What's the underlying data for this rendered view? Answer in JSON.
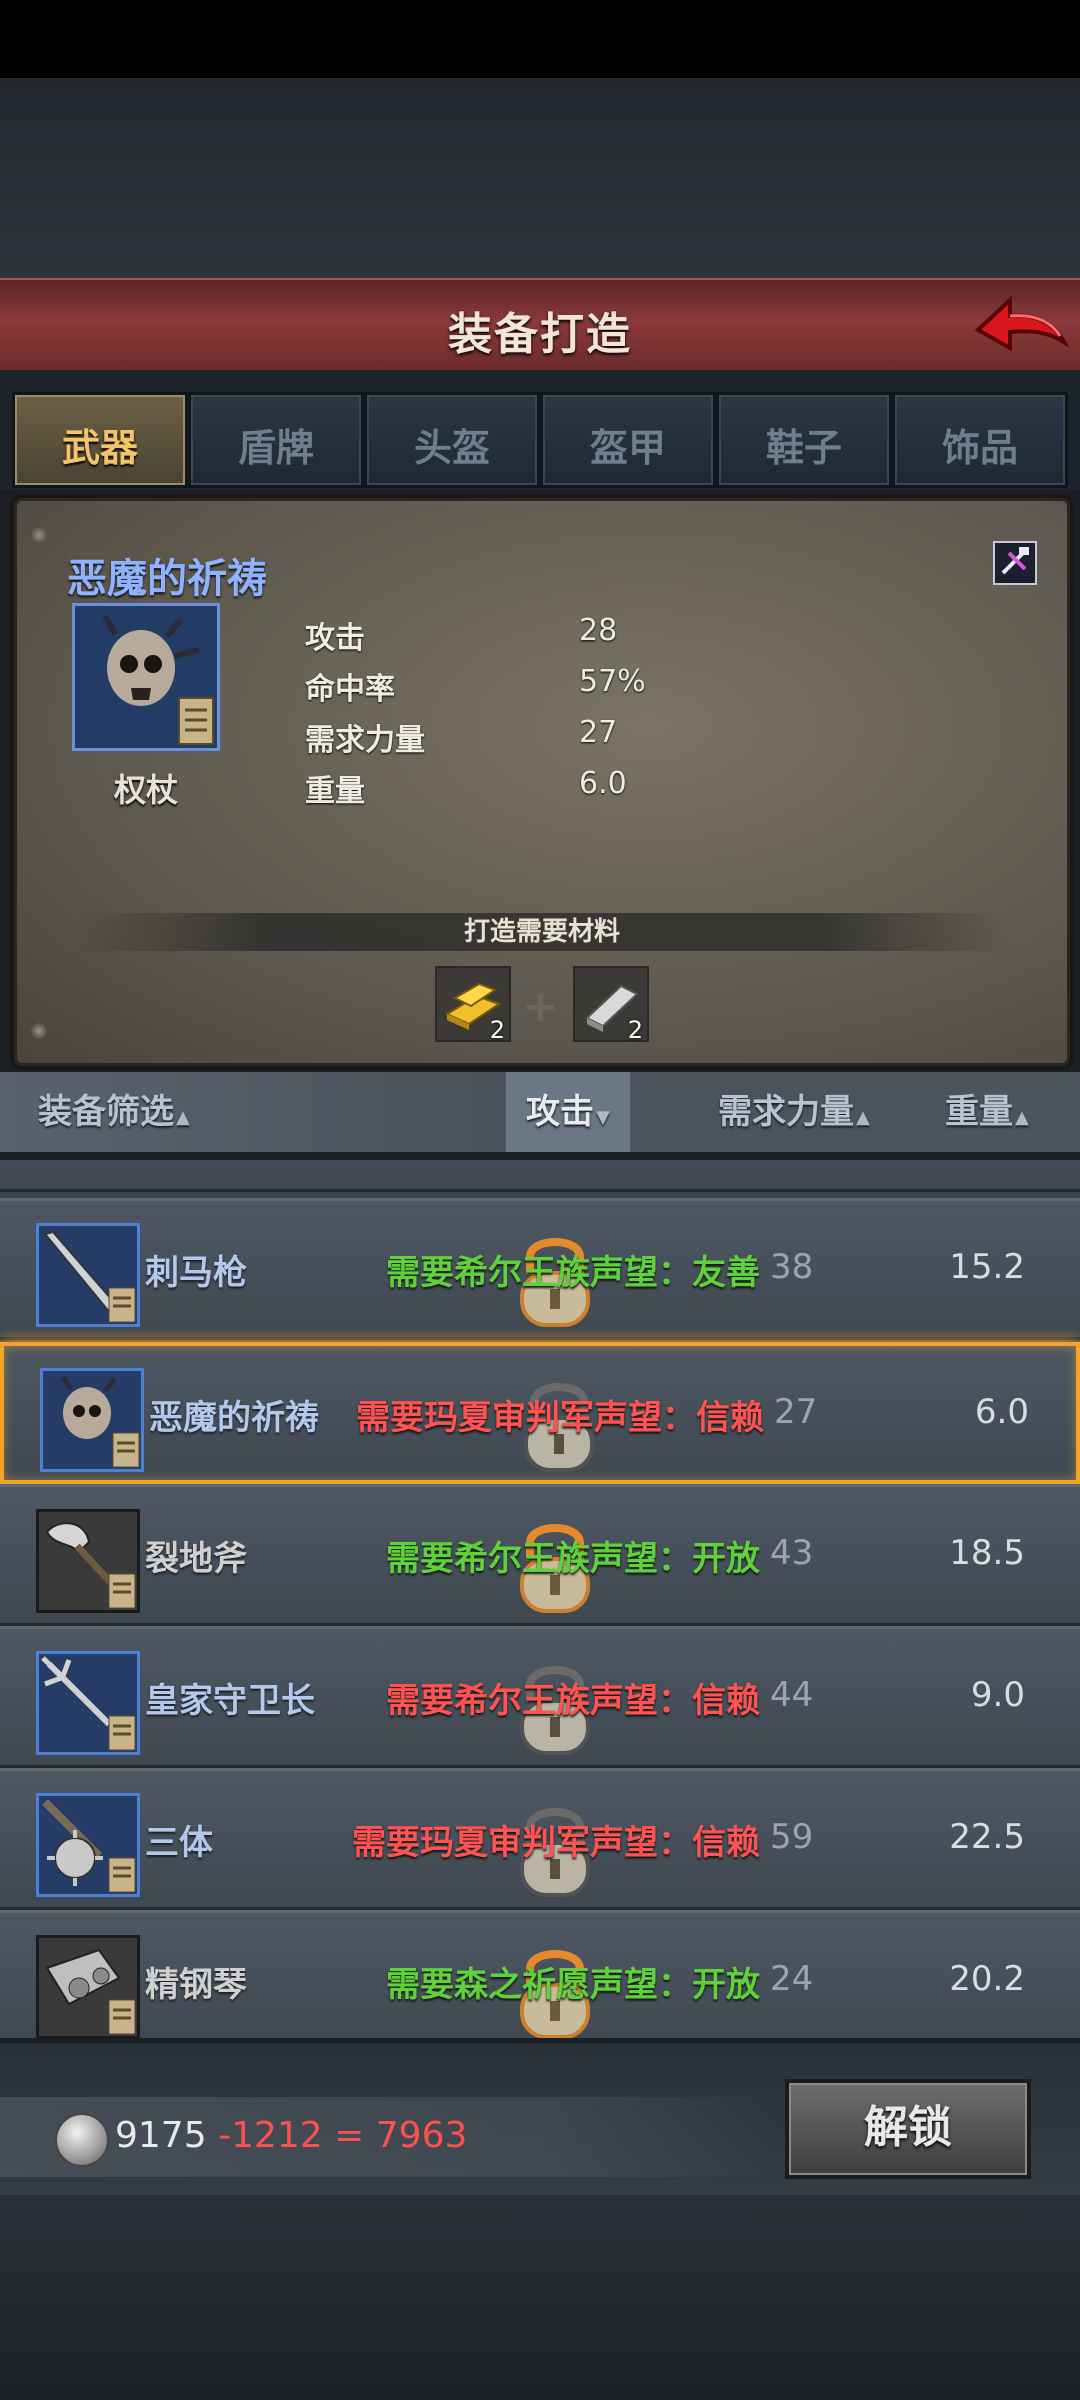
{
  "header": {
    "title": "装备打造"
  },
  "tabs": [
    {
      "label": "武器",
      "active": true
    },
    {
      "label": "盾牌",
      "active": false
    },
    {
      "label": "头盔",
      "active": false
    },
    {
      "label": "盔甲",
      "active": false
    },
    {
      "label": "鞋子",
      "active": false
    },
    {
      "label": "饰品",
      "active": false
    }
  ],
  "detail": {
    "name": "恶魔的祈祷",
    "type": "权杖",
    "stats": [
      {
        "label": "攻击",
        "value": "28"
      },
      {
        "label": "命中率",
        "value": "57%"
      },
      {
        "label": "需求力量",
        "value": "27"
      },
      {
        "label": "重量",
        "value": "6.0"
      }
    ],
    "materials_title": "打造需要材料",
    "materials": [
      {
        "icon": "gold-ingot-icon",
        "count": "2"
      },
      {
        "icon": "silver-ingot-icon",
        "count": "2"
      }
    ]
  },
  "sortbar": {
    "filter": "装备筛选",
    "attack": "攻击",
    "strength": "需求力量",
    "weight": "重量",
    "caret_up": "▲",
    "caret_down": "▼"
  },
  "list": [
    {
      "name": "刺马枪",
      "req": "需要希尔王族声望：友善",
      "req_color": "green",
      "str": "38",
      "weight": "15.2",
      "icon": "spear-icon",
      "frame": "blue"
    },
    {
      "name": "恶魔的祈祷",
      "req": "需要玛夏审判军声望：信赖",
      "req_color": "red",
      "str": "27",
      "weight": "6.0",
      "icon": "skull-scepter-icon",
      "frame": "blue",
      "selected": true
    },
    {
      "name": "裂地斧",
      "req": "需要希尔王族声望：开放",
      "req_color": "green",
      "str": "43",
      "weight": "18.5",
      "icon": "axe-icon",
      "frame": "gray"
    },
    {
      "name": "皇家守卫长",
      "req": "需要希尔王族声望：信赖",
      "req_color": "red",
      "str": "44",
      "weight": "9.0",
      "icon": "trident-icon",
      "frame": "blue"
    },
    {
      "name": "三体",
      "req": "需要玛夏审判军声望：信赖",
      "req_color": "red",
      "str": "59",
      "weight": "22.5",
      "icon": "flail-icon",
      "frame": "blue"
    },
    {
      "name": "精钢琴",
      "req": "需要森之祈愿声望：开放",
      "req_color": "green",
      "str": "24",
      "weight": "20.2",
      "icon": "steel-gauntlet-icon",
      "frame": "gray"
    }
  ],
  "footer": {
    "money": "9175",
    "cost": "-1212",
    "equals": "=",
    "result": "7963",
    "unlock_label": "解锁"
  }
}
